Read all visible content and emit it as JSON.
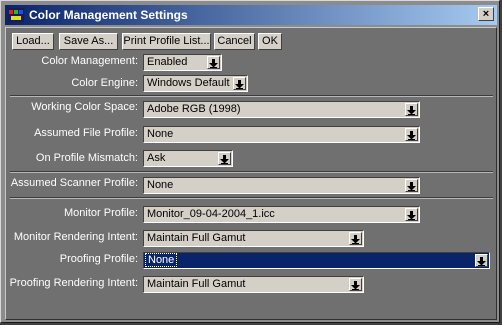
{
  "window": {
    "title": "Color Management Settings"
  },
  "toolbar": {
    "load": "Load...",
    "save_as": "Save As...",
    "print_profile_list": "Print Profile List...",
    "cancel": "Cancel",
    "ok": "OK"
  },
  "fields": {
    "color_management": {
      "label": "Color Management:",
      "value": "Enabled"
    },
    "color_engine": {
      "label": "Color Engine:",
      "value": "Windows Default"
    },
    "working_color_space": {
      "label": "Working Color Space:",
      "value": "Adobe RGB (1998)"
    },
    "assumed_file_profile": {
      "label": "Assumed File Profile:",
      "value": "None"
    },
    "on_profile_mismatch": {
      "label": "On Profile Mismatch:",
      "value": "Ask"
    },
    "assumed_scanner_profile": {
      "label": "Assumed Scanner Profile:",
      "value": "None"
    },
    "monitor_profile": {
      "label": "Monitor Profile:",
      "value": "Monitor_09-04-2004_1.icc"
    },
    "monitor_rendering_intent": {
      "label": "Monitor Rendering Intent:",
      "value": "Maintain Full Gamut"
    },
    "proofing_profile": {
      "label": "Proofing Profile:",
      "value": "None"
    },
    "proofing_rendering_intent": {
      "label": "Proofing Rendering Intent:",
      "value": "Maintain Full Gamut"
    }
  }
}
